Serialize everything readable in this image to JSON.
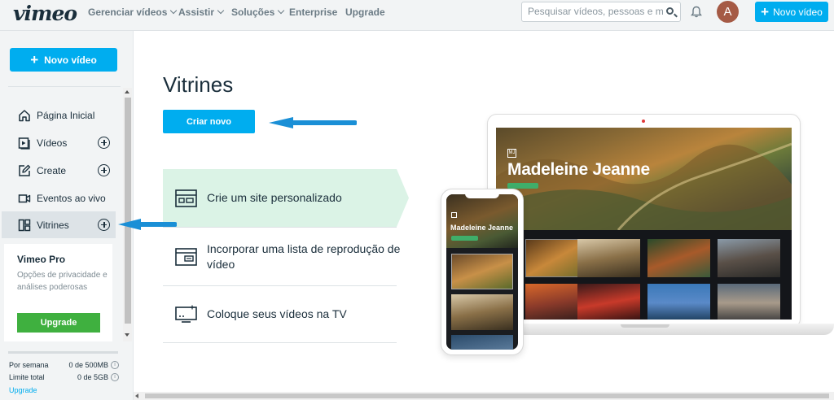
{
  "header": {
    "logo": "vimeo",
    "nav": [
      {
        "label": "Gerenciar vídeos"
      },
      {
        "label": "Assistir"
      },
      {
        "label": "Soluções"
      },
      {
        "label": "Enterprise"
      },
      {
        "label": "Upgrade"
      }
    ],
    "search_placeholder": "Pesquisar vídeos, pessoas e mais",
    "avatar_initial": "A",
    "new_video_label": "Novo vídeo"
  },
  "sidebar": {
    "new_video_label": "Novo vídeo",
    "items": [
      {
        "label": "Página Inicial",
        "icon": "home-icon",
        "addable": false
      },
      {
        "label": "Vídeos",
        "icon": "video-icon",
        "addable": true
      },
      {
        "label": "Create",
        "icon": "edit-icon",
        "addable": true
      },
      {
        "label": "Eventos ao vivo",
        "icon": "live-camera-icon",
        "addable": false
      },
      {
        "label": "Vitrines",
        "icon": "showcase-icon",
        "addable": true,
        "active": true
      }
    ],
    "pro_card": {
      "title": "Vimeo Pro",
      "description": "Opções de privacidade e análises poderosas",
      "button": "Upgrade"
    },
    "quota": {
      "weekly_label": "Por semana",
      "weekly_value": "0 de 500MB",
      "total_label": "Limite total",
      "total_value": "0 de 5GB",
      "upgrade_link": "Upgrade"
    }
  },
  "main": {
    "title": "Vitrines",
    "create_button": "Criar novo",
    "options": [
      {
        "label": "Crie um site personalizado",
        "icon": "website-layout-icon",
        "active": true
      },
      {
        "label": "Incorporar uma lista de reprodução de vídeo",
        "icon": "embed-playlist-icon",
        "active": false
      },
      {
        "label": "Coloque seus vídeos na TV",
        "icon": "tv-icon",
        "active": false
      }
    ],
    "preview": {
      "site_name": "Madeleine Jeanne",
      "logo_text": "MJ"
    }
  },
  "colors": {
    "accent": "#00adef",
    "upgrade": "#3fb03f",
    "active_option": "#dbf3e6",
    "arrow": "#1a8fd6"
  }
}
